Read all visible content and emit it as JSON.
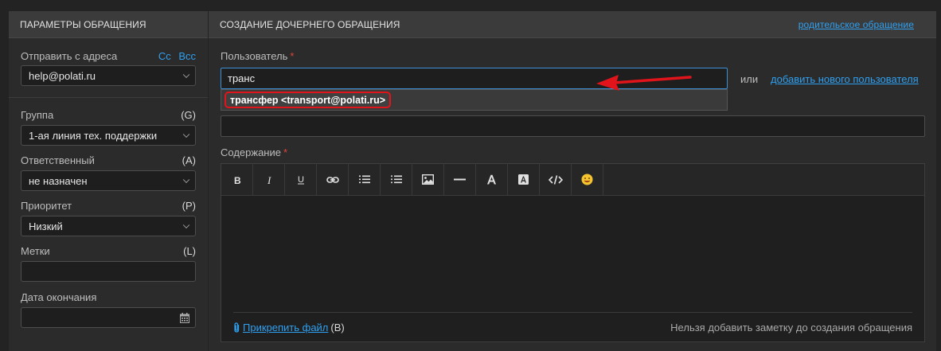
{
  "left_panel": {
    "title": "ПАРАМЕТРЫ ОБРАЩЕНИЯ",
    "from": {
      "label": "Отправить с адреса",
      "cc": "Cc",
      "bcc": "Bcc",
      "value": "help@polati.ru"
    },
    "group": {
      "label": "Группа",
      "key": "(G)",
      "value": "1-ая линия тех. поддержки"
    },
    "assignee": {
      "label": "Ответственный",
      "key": "(A)",
      "value": "не назначен"
    },
    "priority": {
      "label": "Приоритет",
      "key": "(P)",
      "value": "Низкий"
    },
    "tags": {
      "label": "Метки",
      "key": "(L)",
      "value": ""
    },
    "due": {
      "label": "Дата окончания",
      "value": ""
    }
  },
  "right_panel": {
    "title": "СОЗДАНИЕ ДОЧЕРНЕГО ОБРАЩЕНИЯ",
    "parent_link": "родительское обращение",
    "user": {
      "label": "Пользователь",
      "required": "*",
      "value": "транс",
      "suggestion": "трансфер <transport@polati.ru>",
      "or": "или",
      "add_new": "добавить нового пользователя"
    },
    "content": {
      "label": "Содержание",
      "required": "*"
    },
    "toolbar": [
      "bold-icon",
      "italic-icon",
      "underline-icon",
      "link-icon",
      "ordered-list-icon",
      "bullet-list-icon",
      "image-icon",
      "horizontal-rule-icon",
      "font-color-icon",
      "highlight-icon",
      "code-icon",
      "emoji-icon"
    ],
    "attach": {
      "label": "Прикрепить файл",
      "key": "(B)"
    },
    "note": "Нельзя добавить заметку до создания обращения"
  },
  "colors": {
    "accent": "#2fa0f0",
    "required": "#e0453a",
    "annotation": "#e0141a"
  }
}
